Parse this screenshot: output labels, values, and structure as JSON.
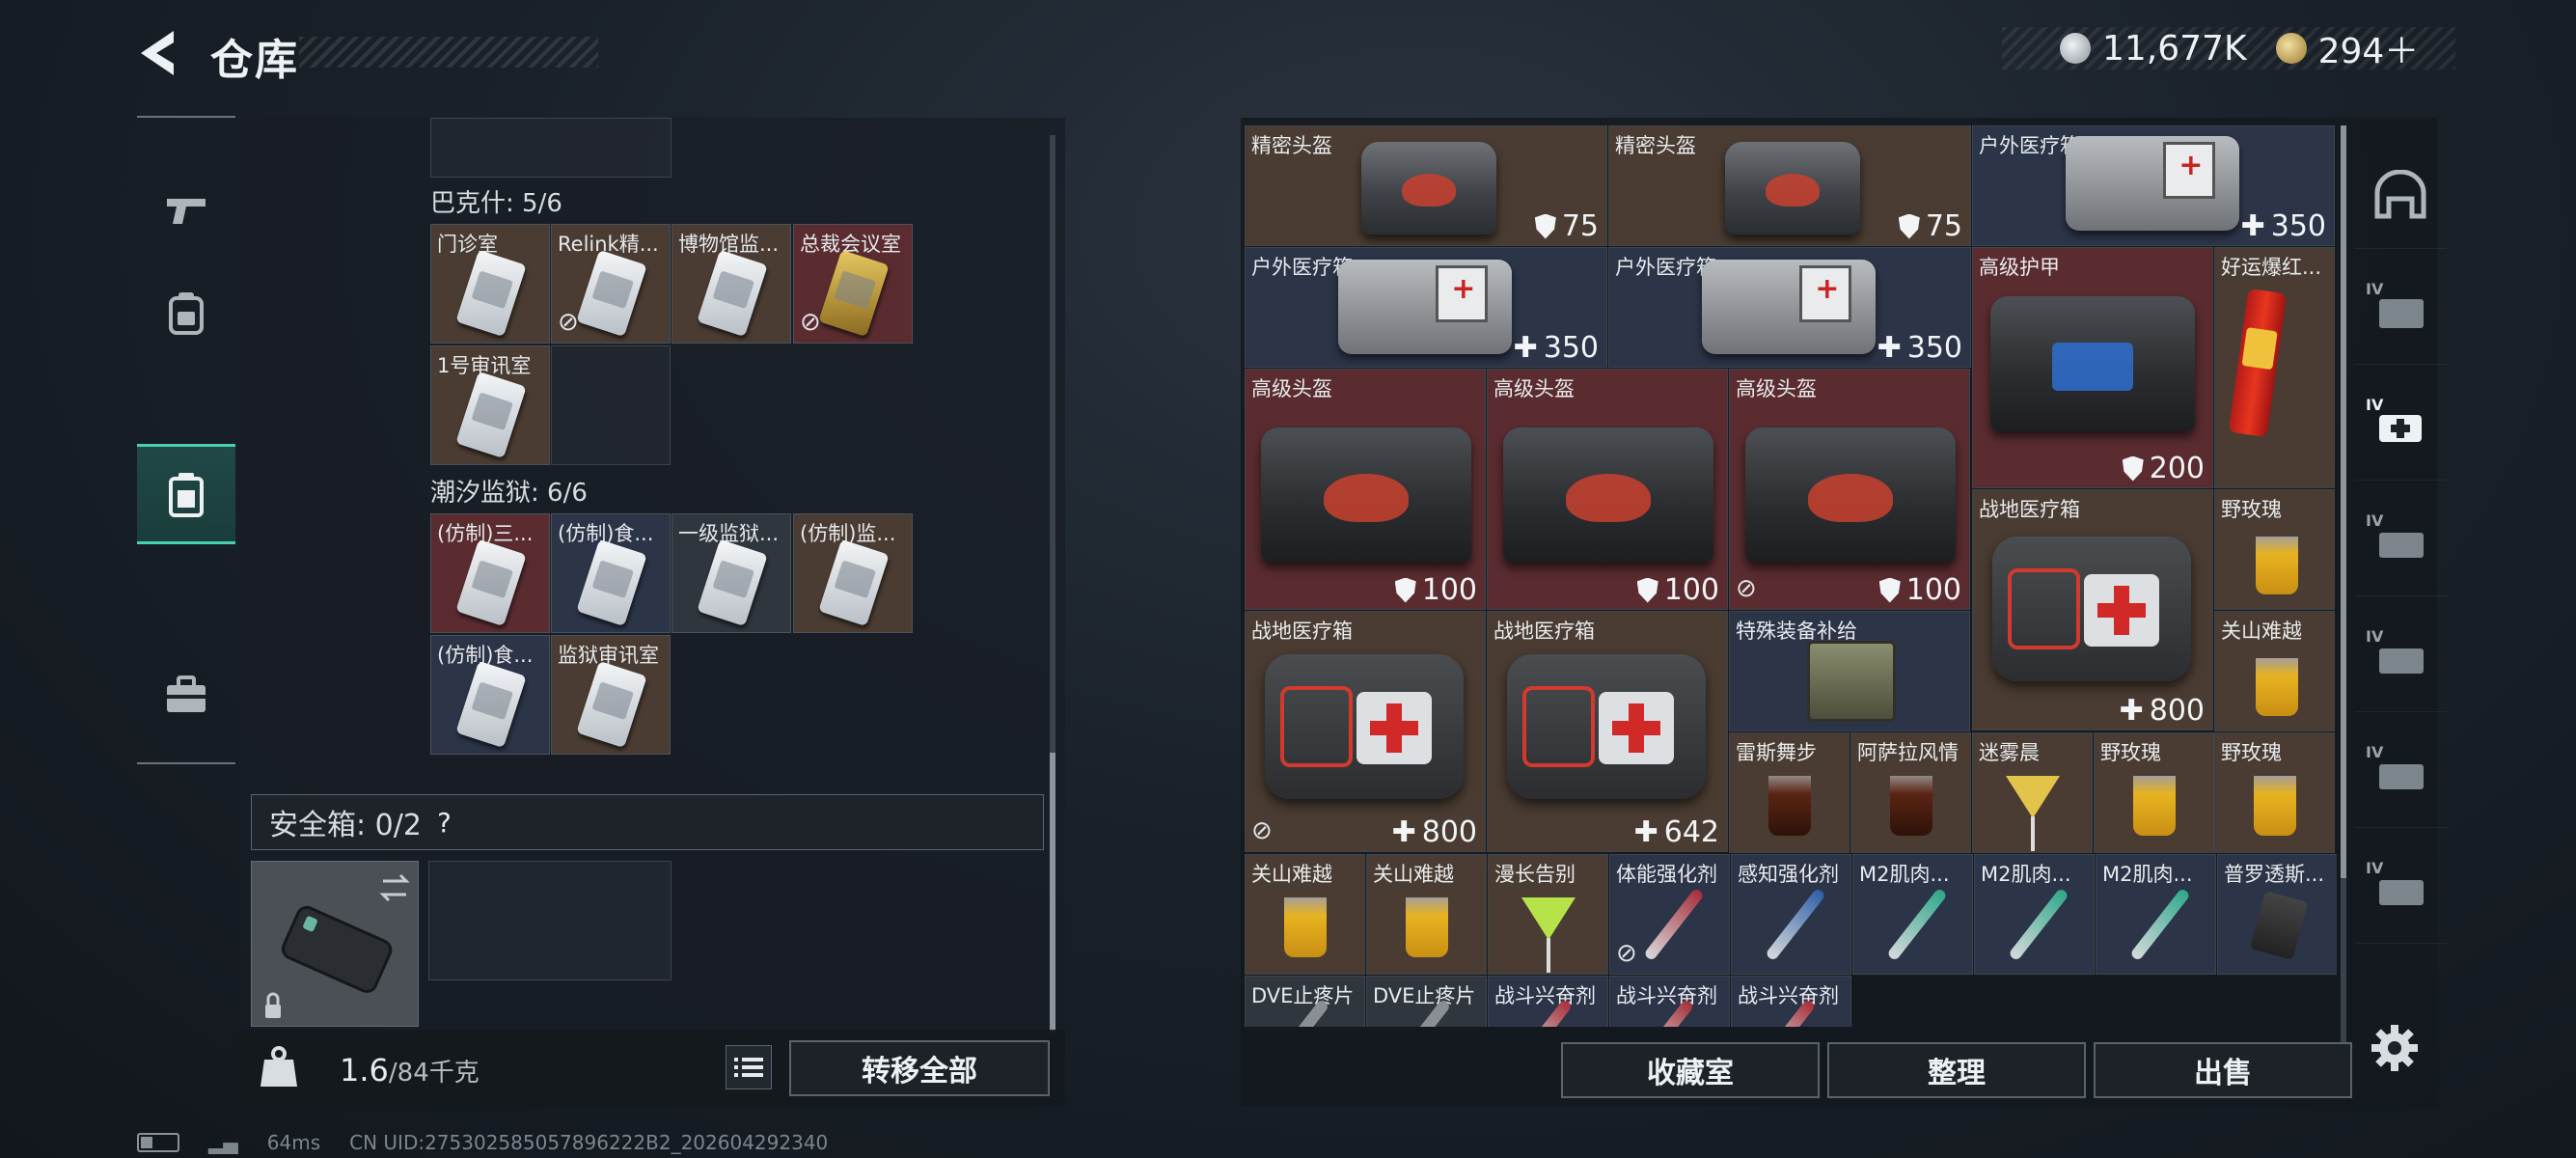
{
  "header": {
    "title": "仓库",
    "currency": [
      {
        "icon": "silver-coin-icon",
        "value": "11,677K"
      },
      {
        "icon": "gold-coin-icon",
        "value": "294＋"
      }
    ]
  },
  "left_nav": [
    {
      "icon": "pistol-icon"
    },
    {
      "icon": "backpack-icon"
    },
    {
      "icon": "vest-icon",
      "active": true
    },
    {
      "icon": "briefcase-icon"
    }
  ],
  "stash": {
    "sections": [
      {
        "title": "巴克什: 5/6",
        "items": [
          "门诊室",
          "Relink精...",
          "博物馆监...",
          "总裁会议室",
          "1号审讯室"
        ]
      },
      {
        "title": "潮汐监狱: 6/6",
        "items": [
          "(仿制)三...",
          "(仿制)食...",
          "一级监狱...",
          "(仿制)监...",
          "(仿制)食...",
          "监狱审讯室"
        ]
      }
    ],
    "safe_box": {
      "label": "安全箱: 0/2",
      "help": "?"
    },
    "weight": {
      "current": "1.6",
      "max": "/84千克"
    },
    "transfer_all": "转移全部"
  },
  "inventory": {
    "items": [
      {
        "name": "精密头盔",
        "value": "75",
        "type": "armor"
      },
      {
        "name": "精密头盔",
        "value": "75",
        "type": "armor"
      },
      {
        "name": "户外医疗箱",
        "value": "350",
        "type": "heal"
      },
      {
        "name": "户外医疗箱",
        "value": "350",
        "type": "heal"
      },
      {
        "name": "户外医疗箱",
        "value": "350",
        "type": "heal"
      },
      {
        "name": "高级护甲",
        "value": "200",
        "type": "armor"
      },
      {
        "name": "好运爆红...",
        "value": "",
        "type": ""
      },
      {
        "name": "高级头盔",
        "value": "100",
        "type": "armor"
      },
      {
        "name": "高级头盔",
        "value": "100",
        "type": "armor"
      },
      {
        "name": "高级头盔",
        "value": "100",
        "type": "armor"
      },
      {
        "name": "战地医疗箱",
        "value": "800",
        "type": "heal"
      },
      {
        "name": "野玫瑰",
        "value": "",
        "type": ""
      },
      {
        "name": "关山难越",
        "value": "",
        "type": ""
      },
      {
        "name": "战地医疗箱",
        "value": "800",
        "type": "heal"
      },
      {
        "name": "战地医疗箱",
        "value": "642",
        "type": "heal"
      },
      {
        "name": "特殊装备补给",
        "value": "",
        "type": ""
      },
      {
        "name": "雷斯舞步",
        "value": "",
        "type": ""
      },
      {
        "name": "阿萨拉风情",
        "value": "",
        "type": ""
      },
      {
        "name": "迷雾晨",
        "value": "",
        "type": ""
      },
      {
        "name": "野玫瑰",
        "value": "",
        "type": ""
      },
      {
        "name": "野玫瑰",
        "value": "",
        "type": ""
      },
      {
        "name": "关山难越",
        "value": "",
        "type": ""
      },
      {
        "name": "关山难越",
        "value": "",
        "type": ""
      },
      {
        "name": "漫长告别",
        "value": "",
        "type": ""
      },
      {
        "name": "体能强化剂",
        "value": "",
        "type": ""
      },
      {
        "name": "感知强化剂",
        "value": "",
        "type": ""
      },
      {
        "name": "M2肌肉...",
        "value": "",
        "type": ""
      },
      {
        "name": "M2肌肉...",
        "value": "",
        "type": ""
      },
      {
        "name": "M2肌肉...",
        "value": "",
        "type": ""
      },
      {
        "name": "普罗透斯...",
        "value": "",
        "type": ""
      },
      {
        "name": "DVE止疼片",
        "value": "",
        "type": ""
      },
      {
        "name": "DVE止疼片",
        "value": "",
        "type": ""
      },
      {
        "name": "战斗兴奋剂",
        "value": "",
        "type": ""
      },
      {
        "name": "战斗兴奋剂",
        "value": "",
        "type": ""
      },
      {
        "name": "战斗兴奋剂",
        "value": "",
        "type": ""
      }
    ],
    "buttons": {
      "collection": "收藏室",
      "sort": "整理",
      "sell": "出售"
    }
  },
  "right_nav": [
    "helmet-icon",
    "tier-IV-folder-icon",
    "tier-IV-medkit-icon",
    "tier-IV-ammo-icon",
    "tier-IV-item-icon",
    "tier-IV-item-icon",
    "tier-IV-item-icon"
  ],
  "status_bar": {
    "ping": "64ms",
    "uid": "CN UID:275302585057896222B2_202604292340"
  },
  "colors": {
    "accent": "#46d1b0",
    "rarity_brown": "#4a3c32",
    "rarity_red": "#5a2c30",
    "rarity_blue": "#2c3448"
  }
}
